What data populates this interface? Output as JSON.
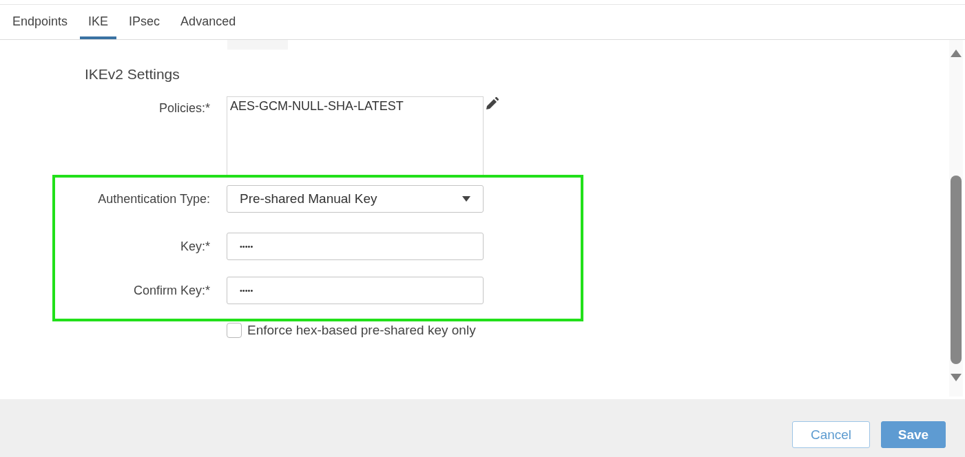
{
  "tabs": [
    {
      "label": "Endpoints",
      "selected": false
    },
    {
      "label": "IKE",
      "selected": true
    },
    {
      "label": "IPsec",
      "selected": false
    },
    {
      "label": "Advanced",
      "selected": false
    }
  ],
  "section_title": "IKEv2 Settings",
  "policies": {
    "label": "Policies:*",
    "items": [
      "AES-GCM-NULL-SHA-LATEST"
    ]
  },
  "authentication_type": {
    "label": "Authentication Type:",
    "value": "Pre-shared Manual Key"
  },
  "key": {
    "label": "Key:*",
    "value": "•••••"
  },
  "confirm_key": {
    "label": "Confirm Key:*",
    "value": "•••••"
  },
  "enforce_hex": {
    "label": "Enforce hex-based pre-shared key only",
    "checked": false
  },
  "buttons": [
    {
      "label": "Cancel",
      "kind": "secondary"
    },
    {
      "label": "Save",
      "kind": "primary"
    }
  ]
}
